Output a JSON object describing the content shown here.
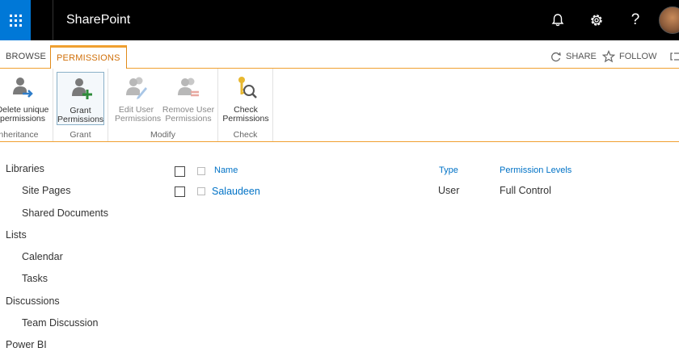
{
  "suitebar": {
    "app_title": "SharePoint",
    "icons": [
      "app-launcher-icon",
      "bell-icon",
      "gear-icon",
      "help-icon"
    ],
    "help_glyph": "?",
    "accent_color": "#0078d7"
  },
  "ribbon": {
    "tabs": [
      {
        "label": "BROWSE",
        "active": false
      },
      {
        "label": "PERMISSIONS",
        "active": true
      }
    ],
    "actions": [
      {
        "label": "SHARE",
        "icon": "share-icon"
      },
      {
        "label": "FOLLOW",
        "icon": "star-icon"
      }
    ],
    "groups": [
      {
        "label": "Inheritance",
        "buttons": [
          {
            "line1": "Delete unique",
            "line2": "permissions",
            "icon": "delete-unique-permissions-icon"
          }
        ]
      },
      {
        "label": "Grant",
        "buttons": [
          {
            "line1": "Grant",
            "line2": "Permissions",
            "icon": "grant-permissions-icon"
          }
        ]
      },
      {
        "label": "Modify",
        "buttons": [
          {
            "line1": "Edit User",
            "line2": "Permissions",
            "icon": "edit-user-permissions-icon"
          },
          {
            "line1": "Remove User",
            "line2": "Permissions",
            "icon": "remove-user-permissions-icon"
          }
        ]
      },
      {
        "label": "Check",
        "buttons": [
          {
            "line1": "Check",
            "line2": "Permissions",
            "icon": "check-permissions-icon"
          }
        ]
      }
    ]
  },
  "leftnav": {
    "items": [
      {
        "label": "Libraries",
        "level": 0
      },
      {
        "label": "Site Pages",
        "level": 1
      },
      {
        "label": "Shared Documents",
        "level": 1
      },
      {
        "label": "Lists",
        "level": 0
      },
      {
        "label": "Calendar",
        "level": 1
      },
      {
        "label": "Tasks",
        "level": 1
      },
      {
        "label": "Discussions",
        "level": 0
      },
      {
        "label": "Team Discussion",
        "level": 1
      },
      {
        "label": "Power BI",
        "level": 0
      }
    ]
  },
  "list": {
    "columns": [
      "Name",
      "Type",
      "Permission Levels"
    ],
    "rows": [
      {
        "name": "Salaudeen",
        "type": "User",
        "permission": "Full Control"
      }
    ]
  }
}
